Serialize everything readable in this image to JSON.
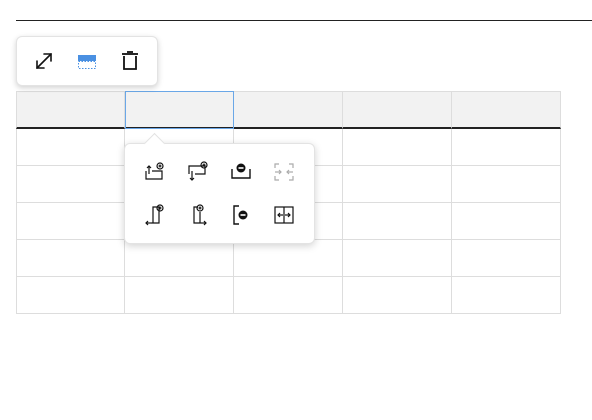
{
  "colors": {
    "accent": "#4a90e2",
    "border": "#dddddd",
    "header_bg": "#f2f2f2",
    "selected_bg": "#eef5fd",
    "icon": "#111111"
  },
  "toolbar": {
    "buttons": [
      {
        "icon": "expand-icon"
      },
      {
        "icon": "header-row-icon"
      },
      {
        "icon": "trash-icon"
      }
    ]
  },
  "table": {
    "columns": 5,
    "header_rows": 1,
    "body_rows": 5,
    "selected_cell": {
      "row": 0,
      "col": 1
    },
    "cells": [
      [
        "",
        "",
        "",
        "",
        ""
      ],
      [
        "",
        "",
        "",
        "",
        ""
      ],
      [
        "",
        "",
        "",
        "",
        ""
      ],
      [
        "",
        "",
        "",
        "",
        ""
      ],
      [
        "",
        "",
        "",
        "",
        ""
      ],
      [
        "",
        "",
        "",
        "",
        ""
      ]
    ]
  },
  "cell_menu": {
    "buttons": [
      {
        "icon": "insert-row-above-icon",
        "enabled": true
      },
      {
        "icon": "insert-row-below-icon",
        "enabled": true
      },
      {
        "icon": "delete-row-icon",
        "enabled": true
      },
      {
        "icon": "merge-cells-icon",
        "enabled": false
      },
      {
        "icon": "insert-column-left-icon",
        "enabled": true
      },
      {
        "icon": "insert-column-right-icon",
        "enabled": true
      },
      {
        "icon": "delete-column-icon",
        "enabled": true
      },
      {
        "icon": "split-cell-icon",
        "enabled": true
      }
    ]
  }
}
